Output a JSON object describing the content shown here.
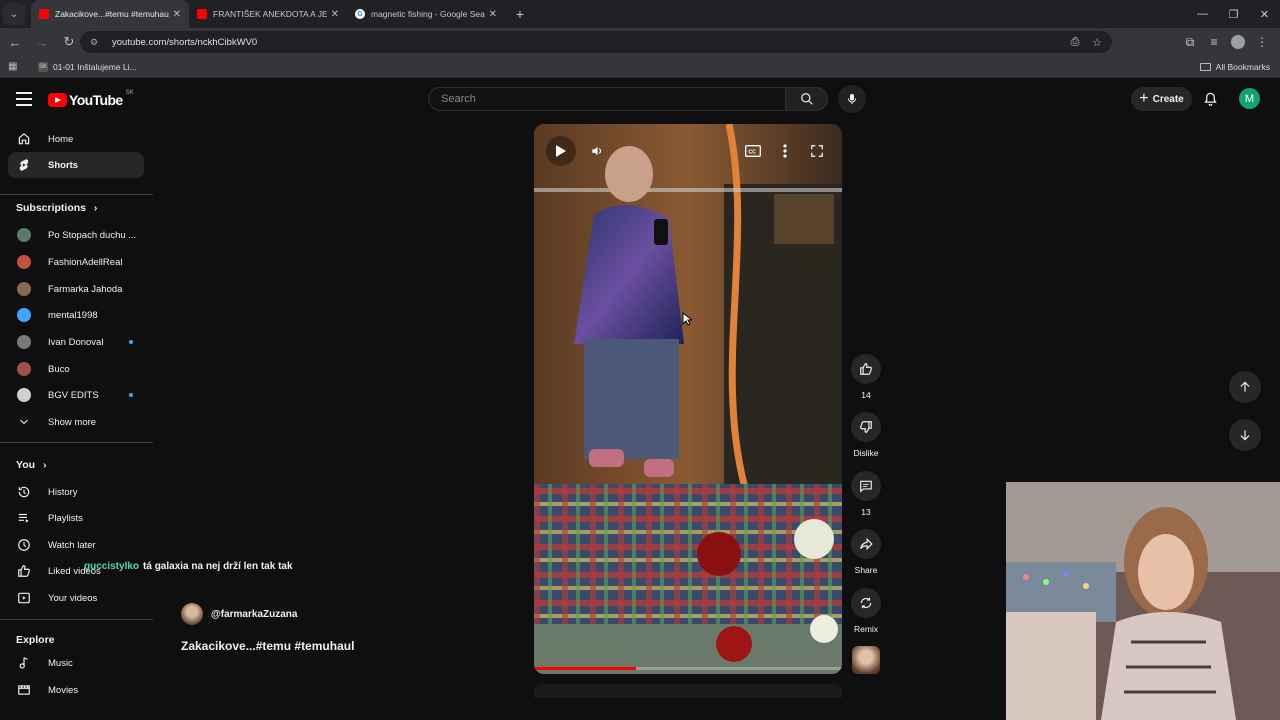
{
  "browser": {
    "tabs": [
      {
        "title": "Zakacikove...#temu #temuhaul",
        "icon": "youtube-favicon",
        "active": true
      },
      {
        "title": "FRANTIŠEK ANEKDOTA A JEHO",
        "icon": "youtube-favicon",
        "active": false
      },
      {
        "title": "magnetic fishing - Google Sear",
        "icon": "google-favicon",
        "active": false
      }
    ],
    "url": "youtube.com/shorts/nckhCibkWV0",
    "bookmarks": [
      {
        "label": "01-01 Inštalujeme Li...",
        "icon": "SK"
      }
    ],
    "all_bookmarks": "All Bookmarks"
  },
  "header": {
    "logo_text": "YouTube",
    "country_code": "SK",
    "search_placeholder": "Search",
    "create_label": "Create",
    "avatar_letter": "M",
    "avatar_color": "#12a36f"
  },
  "sidebar": {
    "main": [
      {
        "label": "Home",
        "icon": "home-icon",
        "active": false
      },
      {
        "label": "Shorts",
        "icon": "shorts-icon",
        "active": true
      }
    ],
    "subscriptions_title": "Subscriptions",
    "subscriptions": [
      {
        "name": "Po Stopach duchu ...",
        "color": "#5a7a6a",
        "live": false
      },
      {
        "name": "FashionAdellReal",
        "color": "#c0503a",
        "live": false
      },
      {
        "name": "Farmarka Jahoda",
        "color": "#8a6a55",
        "live": false
      },
      {
        "name": "mental1998",
        "color": "#3ea6ff",
        "live": false
      },
      {
        "name": "Ivan Donoval",
        "color": "#7a7a7a",
        "live": true
      },
      {
        "name": "Buco",
        "color": "#a0504a",
        "live": false
      },
      {
        "name": "BGV EDITS",
        "color": "#d0d0d0",
        "live": true
      }
    ],
    "show_more": "Show more",
    "you_title": "You",
    "you_items": [
      {
        "label": "History",
        "icon": "history-icon"
      },
      {
        "label": "Playlists",
        "icon": "playlists-icon"
      },
      {
        "label": "Watch later",
        "icon": "watch-later-icon"
      },
      {
        "label": "Liked videos",
        "icon": "liked-icon"
      },
      {
        "label": "Your videos",
        "icon": "your-videos-icon"
      }
    ],
    "explore_title": "Explore",
    "explore_items": [
      {
        "label": "Music",
        "icon": "music-icon"
      },
      {
        "label": "Movies",
        "icon": "movies-icon"
      }
    ]
  },
  "overlay_comment": {
    "user": "guccistylko",
    "message": "tá galaxia na nej drží len tak tak"
  },
  "short": {
    "channel": "@farmarkaZuzana",
    "title": "Zakacikove...#temu #temuhaul",
    "progress": 0.33
  },
  "actions": {
    "likes": "14",
    "dislike_label": "Dislike",
    "comments": "13",
    "share_label": "Share",
    "remix_label": "Remix"
  }
}
